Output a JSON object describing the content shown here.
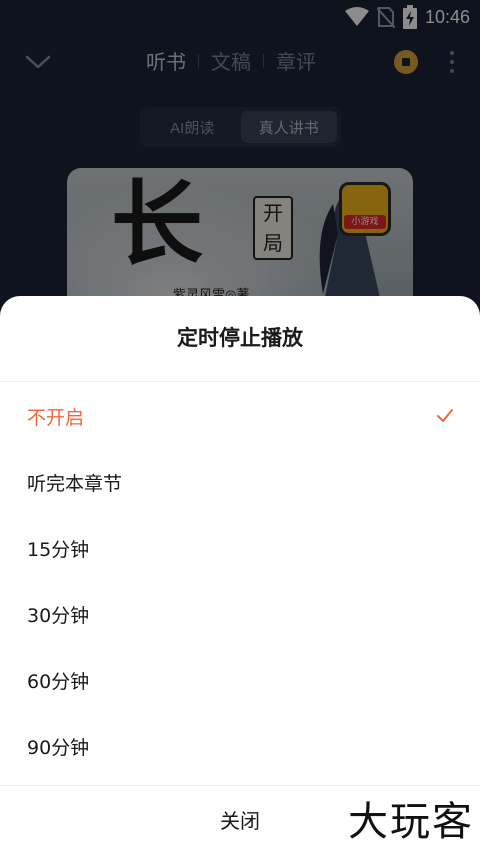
{
  "status_bar": {
    "time": "10:46",
    "icons": [
      "wifi-icon",
      "no-sim-icon",
      "battery-charging-icon"
    ]
  },
  "header": {
    "tabs": [
      {
        "label": "听书",
        "active": true
      },
      {
        "label": "文稿",
        "active": false
      },
      {
        "label": "章评",
        "active": false
      }
    ],
    "icons": [
      "chevron-down-icon",
      "coin-icon",
      "more-vertical-icon"
    ]
  },
  "voice_mode": {
    "options": [
      {
        "label": "AI朗读",
        "active": false
      },
      {
        "label": "真人讲书",
        "active": true
      }
    ]
  },
  "cover": {
    "title_glyph": "长",
    "subtitle": "开局",
    "author_line": "紫灵风雪◎著",
    "game_badge": "小游戏"
  },
  "sleep_timer_sheet": {
    "title": "定时停止播放",
    "options": [
      {
        "label": "不开启",
        "selected": true
      },
      {
        "label": "听完本章节",
        "selected": false
      },
      {
        "label": "15分钟",
        "selected": false
      },
      {
        "label": "30分钟",
        "selected": false
      },
      {
        "label": "60分钟",
        "selected": false
      },
      {
        "label": "90分钟",
        "selected": false
      }
    ],
    "close_label": "关闭",
    "accent_color": "#f0683a"
  },
  "watermark": "大玩客"
}
